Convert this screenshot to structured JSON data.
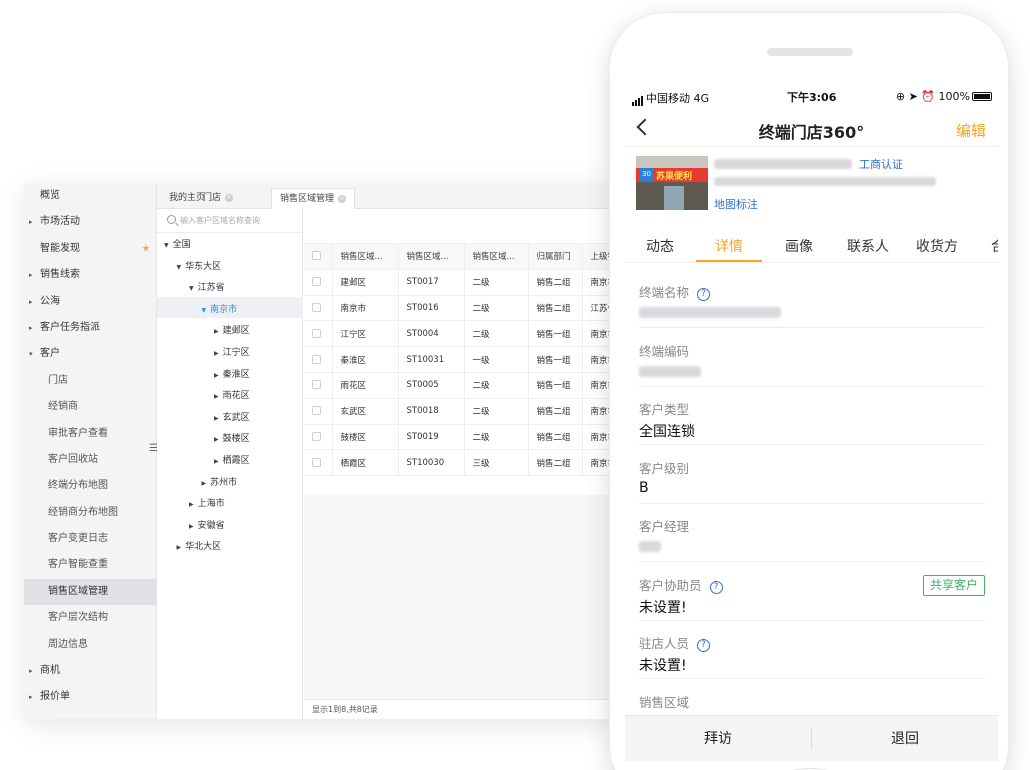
{
  "sidebar": {
    "items": [
      {
        "label": "概览",
        "kind": "top",
        "caret": ""
      },
      {
        "label": "市场活动",
        "kind": "top",
        "caret": "▸"
      },
      {
        "label": "智能发现",
        "kind": "top",
        "caret": "",
        "star": "★"
      },
      {
        "label": "销售线索",
        "kind": "top",
        "caret": "▸"
      },
      {
        "label": "公海",
        "kind": "top",
        "caret": "▸"
      },
      {
        "label": "客户任务指派",
        "kind": "top",
        "caret": "▸"
      },
      {
        "label": "客户",
        "kind": "top",
        "caret": "▾"
      },
      {
        "label": "门店",
        "kind": "sub"
      },
      {
        "label": "经销商",
        "kind": "sub"
      },
      {
        "label": "审批客户查看",
        "kind": "sub"
      },
      {
        "label": "客户回收站",
        "kind": "sub"
      },
      {
        "label": "终端分布地图",
        "kind": "sub"
      },
      {
        "label": "经销商分布地图",
        "kind": "sub"
      },
      {
        "label": "客户变更日志",
        "kind": "sub"
      },
      {
        "label": "客户智能查重",
        "kind": "sub"
      },
      {
        "label": "销售区域管理",
        "kind": "sub",
        "active": true
      },
      {
        "label": "客户层次结构",
        "kind": "sub"
      },
      {
        "label": "周边信息",
        "kind": "sub"
      },
      {
        "label": "商机",
        "kind": "top",
        "caret": "▸"
      },
      {
        "label": "报价单",
        "kind": "top",
        "caret": "▸"
      }
    ],
    "collapse_glyph": "☰"
  },
  "tabs": [
    {
      "label": "我的主页",
      "closable": false
    },
    {
      "label": "门店",
      "closable": true
    },
    {
      "label": "销售区域管理",
      "closable": true,
      "active": true
    }
  ],
  "tab_close_glyph": "×",
  "tree": {
    "search_placeholder": "输入客户区域名称查询",
    "nodes": [
      {
        "label": "全国",
        "arrow": "▼",
        "depth": 0
      },
      {
        "label": "华东大区",
        "arrow": "▼",
        "depth": 1
      },
      {
        "label": "江苏省",
        "arrow": "▼",
        "depth": 2
      },
      {
        "label": "南京市",
        "arrow": "▼",
        "depth": 3,
        "selected": true
      },
      {
        "label": "建邺区",
        "arrow": "▶",
        "depth": 4
      },
      {
        "label": "江宁区",
        "arrow": "▶",
        "depth": 4
      },
      {
        "label": "秦淮区",
        "arrow": "▶",
        "depth": 4
      },
      {
        "label": "雨花区",
        "arrow": "▶",
        "depth": 4
      },
      {
        "label": "玄武区",
        "arrow": "▶",
        "depth": 4
      },
      {
        "label": "鼓楼区",
        "arrow": "▶",
        "depth": 4
      },
      {
        "label": "栖霞区",
        "arrow": "▶",
        "depth": 4
      },
      {
        "label": "苏州市",
        "arrow": "▶",
        "depth": 3
      },
      {
        "label": "上海市",
        "arrow": "▶",
        "depth": 2
      },
      {
        "label": "安徽省",
        "arrow": "▶",
        "depth": 2
      },
      {
        "label": "华北大区",
        "arrow": "▶",
        "depth": 1
      }
    ]
  },
  "table": {
    "headers": [
      "销售区域...",
      "销售区域...",
      "销售区域...",
      "归属部门",
      "上级销"
    ],
    "rows": [
      [
        "建邺区",
        "ST0017",
        "二级",
        "销售二组",
        "南京市"
      ],
      [
        "南京市",
        "ST0016",
        "二级",
        "销售二组",
        "江苏省"
      ],
      [
        "江宁区",
        "ST0004",
        "二级",
        "销售一组",
        "南京市"
      ],
      [
        "秦淮区",
        "ST10031",
        "一级",
        "销售一组",
        "南京市"
      ],
      [
        "雨花区",
        "ST0005",
        "二级",
        "销售一组",
        "南京市"
      ],
      [
        "玄武区",
        "ST0018",
        "二级",
        "销售二组",
        "南京市"
      ],
      [
        "鼓楼区",
        "ST0019",
        "二级",
        "销售二组",
        "南京市"
      ],
      [
        "栖霞区",
        "ST10030",
        "三级",
        "销售二组",
        "南京市"
      ]
    ],
    "footer": "显示1到8,共8记录"
  },
  "phone": {
    "status": {
      "carrier": "中国移动",
      "network": "4G",
      "time": "下午3:06",
      "right": "⊕ ➤ ⏰ 100%"
    },
    "nav": {
      "title": "终端门店360°",
      "edit": "编辑"
    },
    "store": {
      "photo_sign": "苏果便利",
      "photo_number": "30",
      "verify": "工商认证",
      "map_mark": "地图标注"
    },
    "tabs": [
      "动态",
      "详情",
      "画像",
      "联系人",
      "收货方",
      "合"
    ],
    "active_tab_index": 1,
    "fields": [
      {
        "label": "终端名称",
        "value": "",
        "help": true,
        "blurred": true
      },
      {
        "label": "终端编码",
        "value": "",
        "help": false,
        "blurred": true
      },
      {
        "label": "客户类型",
        "value": "全国连锁",
        "help": false
      },
      {
        "label": "客户级别",
        "value": "B",
        "help": false
      },
      {
        "label": "客户经理",
        "value": "",
        "help": false,
        "blurred": true
      },
      {
        "label": "客户协助员",
        "value": "未设置!",
        "help": true,
        "share": "共享客户"
      },
      {
        "label": "驻店人员",
        "value": "未设置!",
        "help": true
      },
      {
        "label": "销售区域",
        "value": "",
        "help": false
      }
    ],
    "help_glyph": "?",
    "actions": {
      "visit": "拜访",
      "back": "退回"
    }
  },
  "colors": {
    "accent": "#f5a623",
    "link": "#2e6fd6",
    "selected_tree": "#2e8be6",
    "share_green": "#3fb16a"
  }
}
